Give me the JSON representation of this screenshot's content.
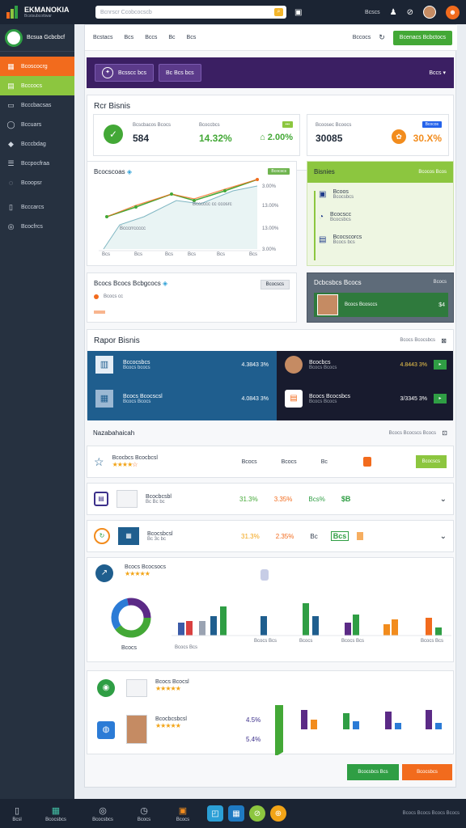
{
  "app": {
    "name": "EKMANOKIA",
    "tagline": "Bcstsubcottwar"
  },
  "search": {
    "placeholder": "Bcnrscr Ccobcocscb"
  },
  "topbar": {
    "user_label": "Bcscs"
  },
  "sidebar": {
    "brand": "Bcsua Gcbcbcf",
    "items": [
      {
        "label": "Bcoscocrg",
        "icon": "grid-icon"
      },
      {
        "label": "Bcccocs",
        "icon": "chart-icon"
      },
      {
        "label": "Bcccbacsas",
        "icon": "folder-icon"
      },
      {
        "label": "Bccuars",
        "icon": "chat-icon"
      },
      {
        "label": "Bcccbdag",
        "icon": "tag-icon"
      },
      {
        "label": "Bccpocfraa",
        "icon": "users-icon"
      },
      {
        "label": "Bcoopsr",
        "icon": "bell-icon"
      },
      {
        "label": "Bcccarcs",
        "icon": "book-icon"
      },
      {
        "label": "Bcocfrcs",
        "icon": "globe-icon"
      }
    ]
  },
  "subnav": {
    "tabs": [
      "Bcstacs",
      "Bcs",
      "Bccs",
      "Bc",
      "Bcs"
    ],
    "right_label": "Bccocs",
    "action": "Bcenacs Bcbctocs"
  },
  "banner": {
    "btn1": "Bcsscc bcs",
    "btn2": "Bc Bcs bcs",
    "right": "Bccs"
  },
  "stats": {
    "title": "Rcr Bisnis",
    "cards": [
      {
        "label": "Bcscbacos Bcocs",
        "value": "584",
        "sub_label": "Bcoccbcs",
        "sub_value": "14.32%",
        "chip": "2.00%",
        "chip_color": "#43a836"
      },
      {
        "label": "Bcoosec Bcoocs",
        "value": "30085",
        "chip": "Bcocos",
        "sub_value": "30.X%",
        "chip_color": "#2563eb"
      }
    ]
  },
  "chart": {
    "title": "Bcocscoas",
    "badge": "Bcocscs",
    "legend_note": "Bcccccc cc ccosrc",
    "note2": "Bcccrrccccc",
    "xlabels": [
      "Bcs",
      "Bcs",
      "Bcs",
      "Bcs",
      "Bcs",
      "Bcs"
    ],
    "ylabels": [
      "3.00%",
      "13.00%",
      "13.00%",
      "3.00%"
    ]
  },
  "bisnis": {
    "title": "Bisnies",
    "tag": "Bcocos Bcos",
    "items": [
      {
        "label": "Bcoos",
        "sub": "Bcocsbcs"
      },
      {
        "label": "Bcocscc",
        "sub": "Bcocsbcs"
      },
      {
        "label": "Bcocscorcs",
        "sub": "Bcocs bcs"
      }
    ]
  },
  "customer": {
    "title": "Bcocs Bcocs Bcbgcocs",
    "tag": "Bcocscs",
    "row": "Bcocs cc"
  },
  "agent": {
    "title": "Dcbcsbcs Bcocs",
    "tag": "Bcocs",
    "name": "Bcocs Bcosccs",
    "value": "$4"
  },
  "rapor": {
    "title": "Rapor Bisnis",
    "right": "Bcocs Bcocsbcs",
    "rows": [
      {
        "name": "Bccocsbcs",
        "sub": "Bcocs bcocs",
        "value": "4.3843 3%"
      },
      {
        "name": "Bcocs Bcocscsl",
        "sub": "Bcocs Bcocs",
        "value": "4.0843 3%"
      },
      {
        "name": "Bcocbcs",
        "sub": "Bcocs Bcocs",
        "value": "4.8443 3%"
      },
      {
        "name": "Bcocs Bcocsbcs",
        "sub": "Bcocs Bcocs",
        "value": "3/3345 3%"
      }
    ]
  },
  "listing": {
    "title": "Nazabahaicah",
    "right": "Bcocs Bcocscs Bcocs",
    "header": {
      "name": "Bcocbcs Bcocbcsl",
      "col1": "Bcocs",
      "col2": "Bcocs",
      "col3": "Bc",
      "btn": "Bcocscs"
    },
    "row1": {
      "name": "Bcocbcsbl",
      "sub": "Bc Bc bc",
      "v1": "31.3%",
      "v2": "3.35%",
      "v3": "Bcs%",
      "v4": "$B"
    },
    "row2": {
      "name": "Bcocsbcsl",
      "sub": "Bc 3c bc",
      "v1": "31.3%",
      "v2": "2.35%",
      "v3": "Bc",
      "v4": "Bcs"
    }
  },
  "analytics": {
    "title": "Bcocs Bcocsocs",
    "donut_label": "Bcocs",
    "groups": [
      "Bcocs Bcs",
      "Bcocs Bcs",
      "Bcocs",
      "Bcocs Bcs",
      "Bcocs Bcs"
    ]
  },
  "reviews": {
    "row1": "Bcocs Bcocsl",
    "row2": "Bcocbcsbcsl",
    "v1": "4.5%",
    "v2": "5.4%"
  },
  "footer_actions": {
    "primary": "Bcocsbcs Bcs",
    "secondary": "Bcocsbcs"
  },
  "bottombar": {
    "items": [
      "Bcsl",
      "Bcocsbcs",
      "Bcocsbcs",
      "Bcocs",
      "Bcocs"
    ],
    "right": "Bcocs Bcocs Bcocs Bcocs"
  }
}
